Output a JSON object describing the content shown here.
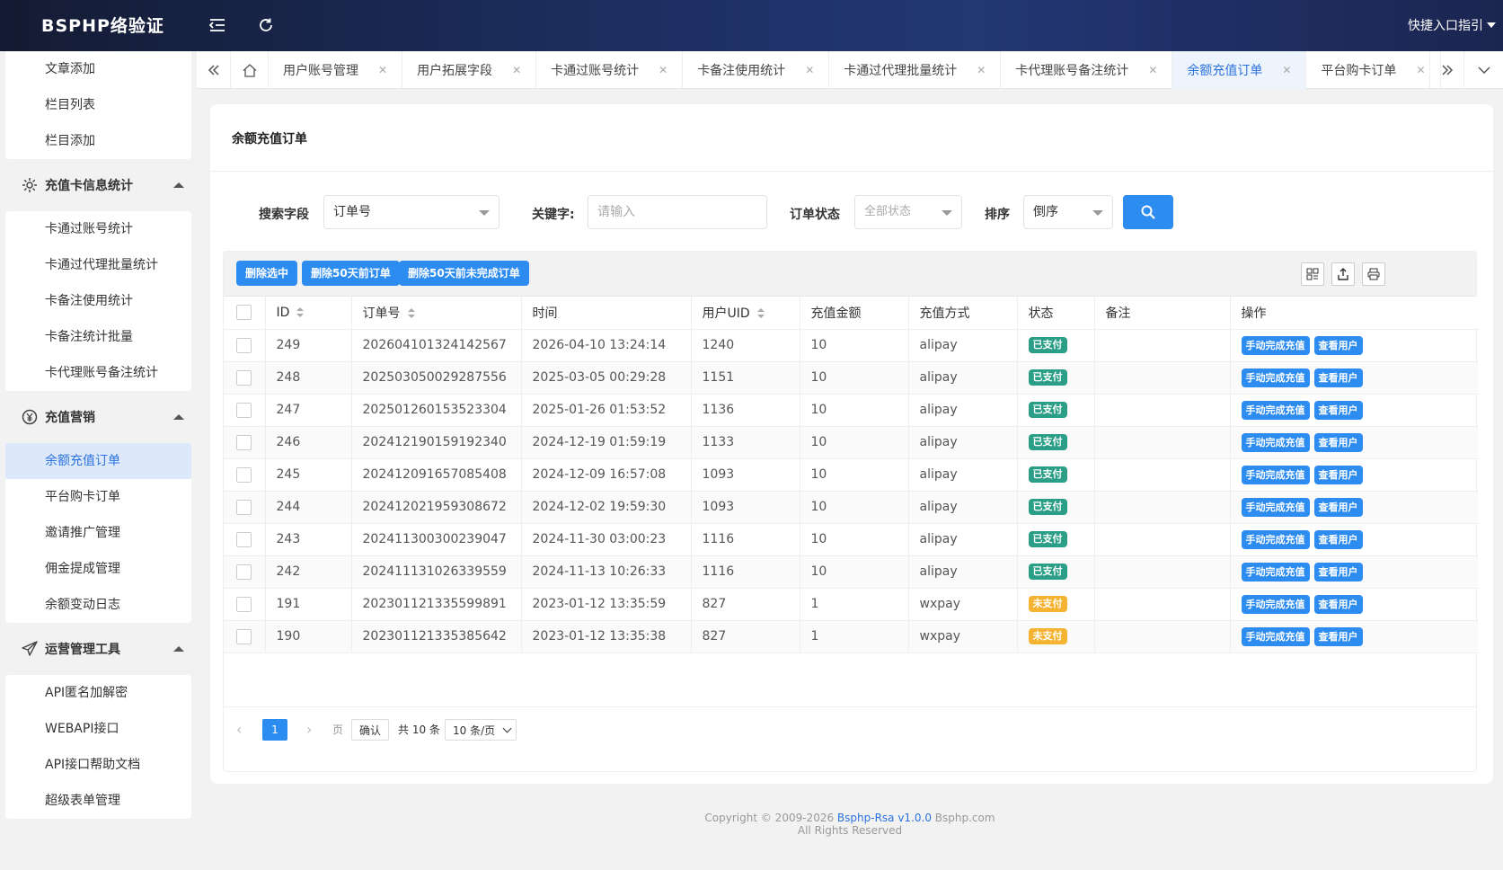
{
  "header": {
    "logo": "BSPHP络验证",
    "quick_entry": "快捷入口指引"
  },
  "sidebar": {
    "top_items": [
      "文章添加",
      "栏目列表",
      "栏目添加"
    ],
    "groups": [
      {
        "title": "充值卡信息统计",
        "icon": "gear-icon",
        "items": [
          "卡通过账号统计",
          "卡通过代理批量统计",
          "卡备注使用统计",
          "卡备注统计批量",
          "卡代理账号备注统计"
        ]
      },
      {
        "title": "充值营销",
        "icon": "yen-icon",
        "items": [
          "余额充值订单",
          "平台购卡订单",
          "邀请推广管理",
          "佣金提成管理",
          "余额变动日志"
        ]
      },
      {
        "title": "运营管理工具",
        "icon": "paper-plane-icon",
        "items": [
          "API匿名加解密",
          "WEBAPI接口",
          "API接口帮助文档",
          "超级表单管理"
        ]
      }
    ],
    "active_item": "余额充值订单"
  },
  "tabs": [
    "用户账号管理",
    "用户拓展字段",
    "卡通过账号统计",
    "卡备注使用统计",
    "卡通过代理批量统计",
    "卡代理账号备注统计",
    "余额充值订单",
    "平台购卡订单"
  ],
  "active_tab": "余额充值订单",
  "page_title": "余额充值订单",
  "search": {
    "field_label": "搜索字段",
    "field_value": "订单号",
    "keyword_label": "关键字:",
    "keyword_placeholder": "请输入",
    "status_label": "订单状态",
    "status_value": "全部状态",
    "order_label": "排序",
    "order_value": "倒序"
  },
  "toolbar": {
    "delete_selected": "删除选中",
    "delete_50": "删除50天前订单",
    "delete_50_unfinished": "删除50天前未完成订单"
  },
  "table": {
    "columns": [
      "ID",
      "订单号",
      "时间",
      "用户UID",
      "充值金额",
      "充值方式",
      "状态",
      "备注",
      "操作"
    ],
    "rows": [
      {
        "id": "249",
        "order": "202604101324142567",
        "time": "2026-04-10 13:24:14",
        "uid": "1240",
        "amount": "10",
        "method": "alipay",
        "status": "已支付",
        "note": ""
      },
      {
        "id": "248",
        "order": "202503050029287556",
        "time": "2025-03-05 00:29:28",
        "uid": "1151",
        "amount": "10",
        "method": "alipay",
        "status": "已支付",
        "note": ""
      },
      {
        "id": "247",
        "order": "202501260153523304",
        "time": "2025-01-26 01:53:52",
        "uid": "1136",
        "amount": "10",
        "method": "alipay",
        "status": "已支付",
        "note": ""
      },
      {
        "id": "246",
        "order": "202412190159192340",
        "time": "2024-12-19 01:59:19",
        "uid": "1133",
        "amount": "10",
        "method": "alipay",
        "status": "已支付",
        "note": ""
      },
      {
        "id": "245",
        "order": "202412091657085408",
        "time": "2024-12-09 16:57:08",
        "uid": "1093",
        "amount": "10",
        "method": "alipay",
        "status": "已支付",
        "note": ""
      },
      {
        "id": "244",
        "order": "202412021959308672",
        "time": "2024-12-02 19:59:30",
        "uid": "1093",
        "amount": "10",
        "method": "alipay",
        "status": "已支付",
        "note": ""
      },
      {
        "id": "243",
        "order": "202411300300239047",
        "time": "2024-11-30 03:00:23",
        "uid": "1116",
        "amount": "10",
        "method": "alipay",
        "status": "已支付",
        "note": ""
      },
      {
        "id": "242",
        "order": "202411131026339559",
        "time": "2024-11-13 10:26:33",
        "uid": "1116",
        "amount": "10",
        "method": "alipay",
        "status": "已支付",
        "note": ""
      },
      {
        "id": "191",
        "order": "202301121335599891",
        "time": "2023-01-12 13:35:59",
        "uid": "827",
        "amount": "1",
        "method": "wxpay",
        "status": "未支付",
        "note": ""
      },
      {
        "id": "190",
        "order": "202301121335385642",
        "time": "2023-01-12 13:35:38",
        "uid": "827",
        "amount": "1",
        "method": "wxpay",
        "status": "未支付",
        "note": ""
      }
    ],
    "actions": [
      "手动完成充值",
      "查看用户"
    ]
  },
  "pagination": {
    "current": "1",
    "page_word": "页",
    "confirm": "确认",
    "total": "共 10 条",
    "page_size": "10 条/页"
  },
  "footer": {
    "line1_prefix": "Copyright © 2009-2026",
    "line1_link": "Bsphp-Rsa v1.0.0",
    "line1_suffix": "Bsphp.com",
    "line2": "All Rights Reserved"
  },
  "colors": {
    "accent": "#2d8cf0",
    "paid": "#2a9e86",
    "unpaid": "#f5b331",
    "header": "#1b2c5a"
  }
}
